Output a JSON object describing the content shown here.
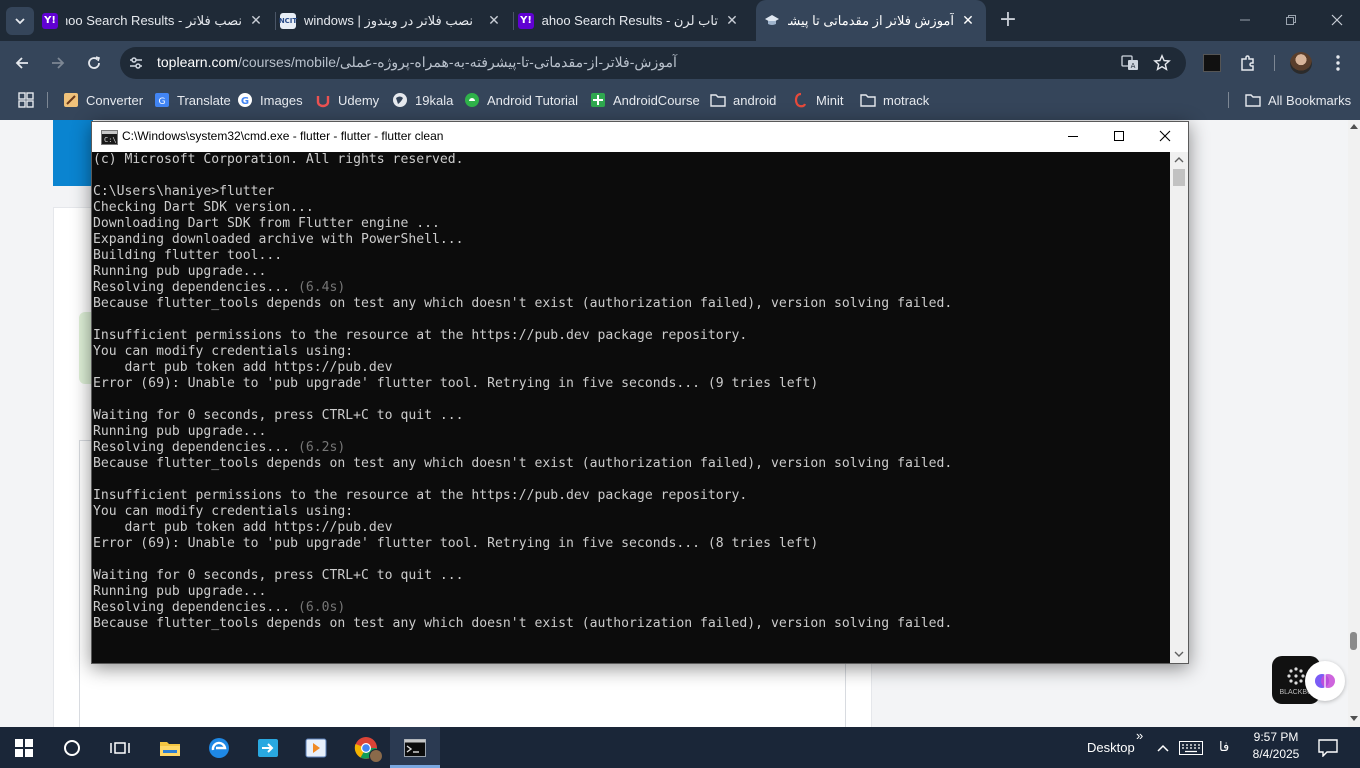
{
  "tabs": [
    {
      "title": "نصب فلاتر - Yahoo Search Results",
      "active": false
    },
    {
      "title": "نصب فلاتر در ویندوز | windows",
      "active": false
    },
    {
      "title": "تاب لرن - Yahoo Search Results",
      "active": false
    },
    {
      "title": "آموزش فلاتر از مقدماتی تا پیشرفته",
      "active": true
    }
  ],
  "new_tab": "+",
  "address": {
    "host": "toplearn.com",
    "path": "/courses/mobile/آموزش-فلاتر-از-مقدماتی-تا-پیشرفته-به-همراه-پروژه-عملی"
  },
  "bookmarks": [
    {
      "label": "Converter"
    },
    {
      "label": "Translate"
    },
    {
      "label": "Images"
    },
    {
      "label": "Udemy"
    },
    {
      "label": "19kala"
    },
    {
      "label": "Android Tutorial"
    },
    {
      "label": "AndroidCourse"
    },
    {
      "label": "android"
    },
    {
      "label": "Minit"
    },
    {
      "label": "motrack"
    }
  ],
  "all_bookmarks": "All Bookmarks",
  "cmd": {
    "title": "C:\\Windows\\system32\\cmd.exe - flutter - flutter - flutter  clean",
    "lines": [
      {
        "t": "(c) Microsoft Corporation. All rights reserved."
      },
      {
        "t": ""
      },
      {
        "t": "C:\\Users\\haniye>flutter"
      },
      {
        "t": "Checking Dart SDK version..."
      },
      {
        "t": "Downloading Dart SDK from Flutter engine ..."
      },
      {
        "t": "Expanding downloaded archive with PowerShell..."
      },
      {
        "t": "Building flutter tool..."
      },
      {
        "t": "Running pub upgrade..."
      },
      {
        "t": "Resolving dependencies... ",
        "d": "(6.4s)"
      },
      {
        "t": "Because flutter_tools depends on test any which doesn't exist (authorization failed), version solving failed."
      },
      {
        "t": ""
      },
      {
        "t": "Insufficient permissions to the resource at the https://pub.dev package repository."
      },
      {
        "t": "You can modify credentials using:"
      },
      {
        "t": "    dart pub token add https://pub.dev"
      },
      {
        "t": "Error (69): Unable to 'pub upgrade' flutter tool. Retrying in five seconds... (9 tries left)"
      },
      {
        "t": ""
      },
      {
        "t": "Waiting for 0 seconds, press CTRL+C to quit ..."
      },
      {
        "t": "Running pub upgrade..."
      },
      {
        "t": "Resolving dependencies... ",
        "d": "(6.2s)"
      },
      {
        "t": "Because flutter_tools depends on test any which doesn't exist (authorization failed), version solving failed."
      },
      {
        "t": ""
      },
      {
        "t": "Insufficient permissions to the resource at the https://pub.dev package repository."
      },
      {
        "t": "You can modify credentials using:"
      },
      {
        "t": "    dart pub token add https://pub.dev"
      },
      {
        "t": "Error (69): Unable to 'pub upgrade' flutter tool. Retrying in five seconds... (8 tries left)"
      },
      {
        "t": ""
      },
      {
        "t": "Waiting for 0 seconds, press CTRL+C to quit ..."
      },
      {
        "t": "Running pub upgrade..."
      },
      {
        "t": "Resolving dependencies... ",
        "d": "(6.0s)"
      },
      {
        "t": "Because flutter_tools depends on test any which doesn't exist (authorization failed), version solving failed."
      }
    ]
  },
  "taskbar": {
    "desktop_label": "Desktop",
    "overflow": "»",
    "lang": "فا",
    "time": "9:57 PM",
    "date": "8/4/2025"
  },
  "widget_label": "BLACKBO",
  "colors": {
    "accent": "#1f2a37",
    "toolbar": "#35455a",
    "console_bg": "#0c0c0c",
    "console_fg": "#cccccc"
  }
}
